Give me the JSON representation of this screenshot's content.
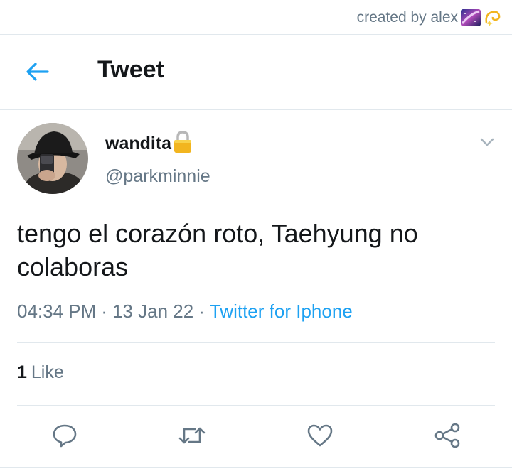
{
  "credit": {
    "text": "created by alex",
    "emoji_icons": [
      "milky-way-icon",
      "dizzy-icon"
    ]
  },
  "header": {
    "title": "Tweet",
    "back_icon": "back-arrow-icon"
  },
  "tweet": {
    "display_name": "wandita",
    "name_icon": "lock-icon",
    "handle": "@parkminnie",
    "text": "tengo el corazón roto, Taehyung no colaboras",
    "time": "04:34 PM",
    "date": "13 Jan 22",
    "source": "Twitter for Iphone",
    "separator": "·"
  },
  "stats": {
    "like_count": "1",
    "like_label": "Like"
  },
  "actions": [
    "reply-icon",
    "retweet-icon",
    "like-icon",
    "share-icon"
  ],
  "colors": {
    "accent": "#1da1f2",
    "secondary_text": "#657786",
    "primary_text": "#14171a",
    "divider": "#e1e8ed"
  }
}
